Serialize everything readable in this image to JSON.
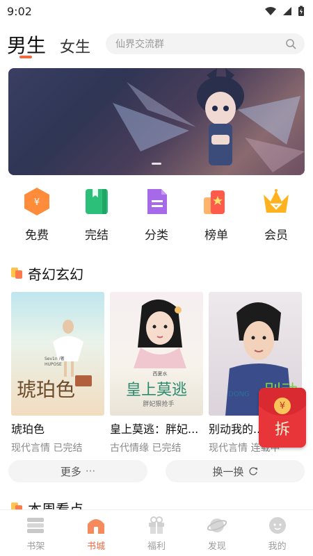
{
  "status_bar": {
    "time": "9:02"
  },
  "header": {
    "tab_male": "男生",
    "tab_female": "女生",
    "search_placeholder": "仙界交流群"
  },
  "categories": [
    {
      "label": "免费",
      "icon": "coin-hexagon-icon",
      "color": "#ff8c3a"
    },
    {
      "label": "完结",
      "icon": "book-icon",
      "color": "#2bbf7a"
    },
    {
      "label": "分类",
      "icon": "document-icon",
      "color": "#a66ae8"
    },
    {
      "label": "榜单",
      "icon": "ranking-icon",
      "color": "#ff5a4a"
    },
    {
      "label": "会员",
      "icon": "crown-icon",
      "color": "#ffb21f"
    }
  ],
  "section1": {
    "title": "奇幻玄幻"
  },
  "books": [
    {
      "title": "琥珀色",
      "meta": "现代言情 已完结",
      "cover_text": "琥珀色",
      "cover_author": "Sev1n /著",
      "cover_sub": "HUPOSE"
    },
    {
      "title": "皇上莫逃：胖妃...",
      "meta": "古代情缘 已完结",
      "cover_text": "皇上莫逃",
      "cover_author": "西夏水",
      "cover_sub": "胖妃狠抢手"
    },
    {
      "title": "别动我的...",
      "meta": "现代言情 连载中",
      "cover_text": "别动",
      "cover_author": "DONG",
      "cover_sub": "我的"
    }
  ],
  "buttons": {
    "more": "更多",
    "more_icon": "···",
    "refresh": "换一换"
  },
  "red_packet": {
    "label": "拆",
    "coin": "¥"
  },
  "section2": {
    "title": "本周看点"
  },
  "bottom_nav": [
    {
      "label": "书架",
      "icon": "bookshelf-icon"
    },
    {
      "label": "书城",
      "icon": "bookstore-icon",
      "active": true
    },
    {
      "label": "福利",
      "icon": "gift-icon"
    },
    {
      "label": "发现",
      "icon": "planet-icon"
    },
    {
      "label": "我的",
      "icon": "profile-icon"
    }
  ],
  "colors": {
    "accent": "#f06a3f",
    "muted_text": "#8a8a8a"
  }
}
